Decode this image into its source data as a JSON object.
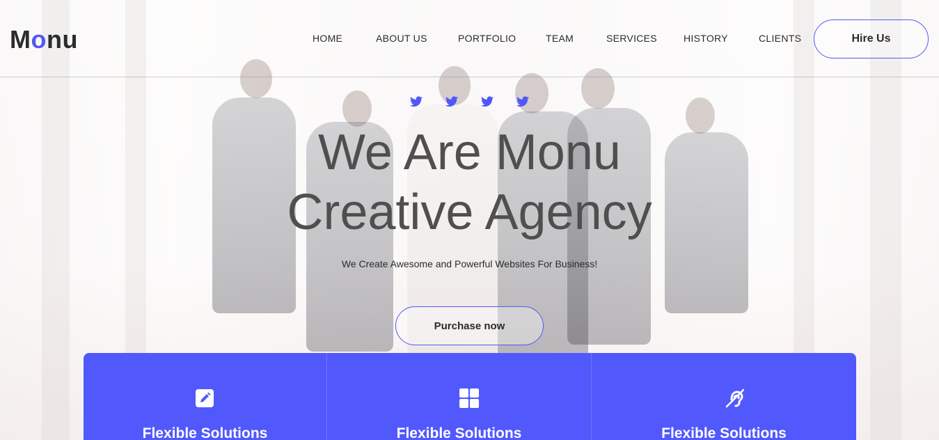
{
  "brand": {
    "logo_prefix": "M",
    "logo_accent": "o",
    "logo_suffix": "nu",
    "accent_color": "#5058f7"
  },
  "nav": {
    "items": [
      "HOME",
      "ABOUT US",
      "PORTFOLIO",
      "TEAM",
      "SERVICES",
      "HISTORY",
      "CLIENTS"
    ],
    "cta_label": "Hire Us"
  },
  "social": {
    "icons": [
      "twitter-icon",
      "twitter-icon",
      "twitter-icon",
      "twitter-icon"
    ]
  },
  "hero": {
    "title_line1": "We Are Monu",
    "title_line2": "Creative Agency",
    "subtitle": "We Create Awesome and Powerful Websites For Business!",
    "button_label": "Purchase now"
  },
  "features": {
    "background": "#5159fd",
    "items": [
      {
        "icon": "edit-icon",
        "title": "Flexible Solutions"
      },
      {
        "icon": "grid-icon",
        "title": "Flexible Solutions"
      },
      {
        "icon": "hearing-icon",
        "title": "Flexible Solutions"
      }
    ]
  }
}
